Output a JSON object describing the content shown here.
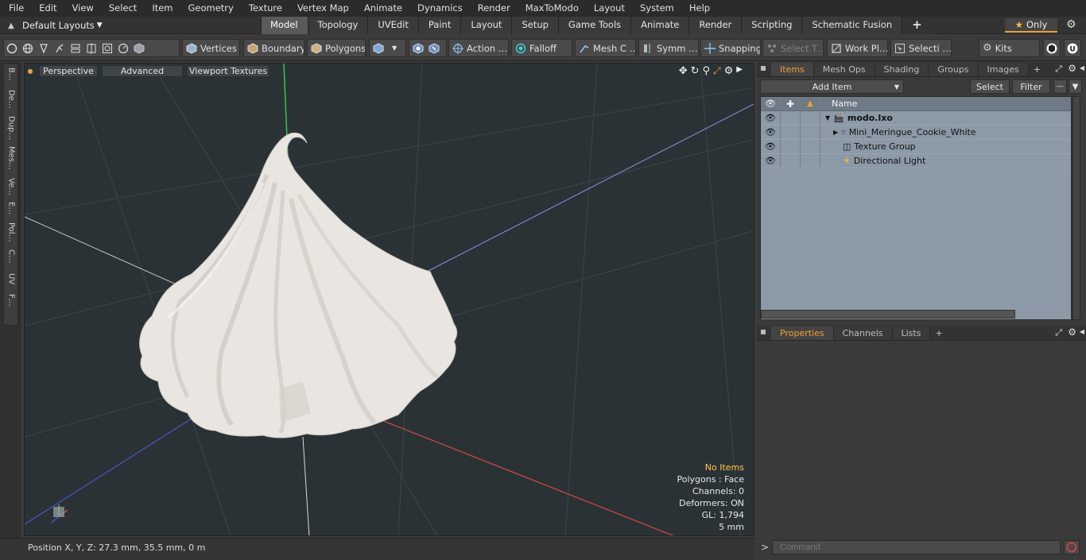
{
  "menu": [
    "File",
    "Edit",
    "View",
    "Select",
    "Item",
    "Geometry",
    "Texture",
    "Vertex Map",
    "Animate",
    "Dynamics",
    "Render",
    "MaxToModo",
    "Layout",
    "System",
    "Help"
  ],
  "layouts_label": "Default Layouts",
  "tabs": [
    "Model",
    "Topology",
    "UVEdit",
    "Paint",
    "Layout",
    "Setup",
    "Game Tools",
    "Animate",
    "Render",
    "Scripting",
    "Schematic Fusion"
  ],
  "active_tab": "Model",
  "only_label": "Only",
  "toolbar": {
    "vertices": "Vertices",
    "boundary": "Boundary",
    "polygons": "Polygons",
    "action": "Action …",
    "falloff": "Falloff",
    "mesh": "Mesh C …",
    "symm": "Symm …",
    "snapping": "Snapping",
    "select_t": "Select T…",
    "workplane": "Work Pl…",
    "selecti": "Selecti …",
    "kits": "Kits"
  },
  "left_tabs": [
    "B…",
    "De…",
    "Dup…",
    "Mes…",
    "Ve…",
    "E…",
    "Pol…",
    "C…",
    "UV",
    "F…"
  ],
  "viewport": {
    "perspective": "Perspective",
    "advanced": "Advanced",
    "viewport_textures": "Viewport Textures",
    "stats": {
      "no_items": "No Items",
      "polygons": "Polygons : Face",
      "channels": "Channels: 0",
      "deformers": "Deformers: ON",
      "gl": "GL: 1,794",
      "scale": "5 mm"
    }
  },
  "status": {
    "position": "Position X, Y, Z:   27.3 mm, 35.5 mm, 0 m"
  },
  "items_panel": {
    "tabs": [
      "Items",
      "Mesh Ops",
      "Shading",
      "Groups",
      "Images"
    ],
    "active": "Items",
    "add_item": "Add Item",
    "select": "Select",
    "filter": "Filter",
    "name_header": "Name",
    "rows": [
      {
        "name": "modo.lxo",
        "bold": true,
        "indent": 0
      },
      {
        "name": "Mini_Meringue_Cookie_White",
        "bold": false,
        "indent": 1
      },
      {
        "name": "Texture Group",
        "bold": false,
        "indent": 1
      },
      {
        "name": "Directional Light",
        "bold": false,
        "indent": 1
      }
    ]
  },
  "properties_panel": {
    "tabs": [
      "Properties",
      "Channels",
      "Lists"
    ],
    "active": "Properties"
  },
  "command_placeholder": "Command"
}
